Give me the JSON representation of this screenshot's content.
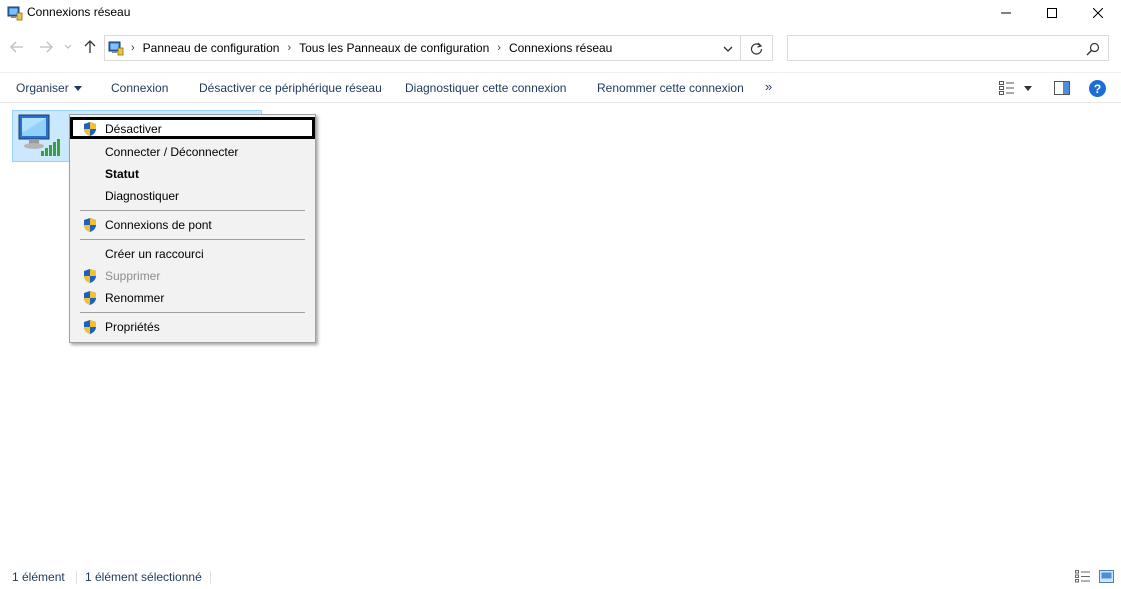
{
  "window": {
    "title": "Connexions réseau",
    "controls": [
      "minimize",
      "maximize",
      "close"
    ]
  },
  "address_bar": {
    "breadcrumbs": [
      {
        "label": "Panneau de configuration"
      },
      {
        "label": "Tous les Panneaux de configuration"
      },
      {
        "label": "Connexions réseau"
      }
    ],
    "search_value": ""
  },
  "command_bar": {
    "organiser": "Organiser",
    "connexion": "Connexion",
    "desactiver": "Désactiver ce périphérique réseau",
    "diagnostiquer": "Diagnostiquer cette connexion",
    "renommer": "Renommer cette connexion",
    "more": "»",
    "help": "?"
  },
  "context_menu": {
    "items": [
      {
        "label": "Désactiver",
        "shield": true,
        "bold": false,
        "disabled": false,
        "focused": true
      },
      {
        "label": "Connecter / Déconnecter",
        "shield": false,
        "bold": false,
        "disabled": false,
        "focused": false
      },
      {
        "label": "Statut",
        "shield": false,
        "bold": true,
        "disabled": false,
        "focused": false
      },
      {
        "label": "Diagnostiquer",
        "shield": false,
        "bold": false,
        "disabled": false,
        "focused": false
      },
      {
        "label": "Connexions de pont",
        "shield": true,
        "bold": false,
        "disabled": false,
        "focused": false
      },
      {
        "label": "Créer un raccourci",
        "shield": false,
        "bold": false,
        "disabled": false,
        "focused": false
      },
      {
        "label": "Supprimer",
        "shield": true,
        "bold": false,
        "disabled": true,
        "focused": false
      },
      {
        "label": "Renommer",
        "shield": true,
        "bold": false,
        "disabled": false,
        "focused": false
      },
      {
        "label": "Propriétés",
        "shield": true,
        "bold": false,
        "disabled": false,
        "focused": false
      }
    ]
  },
  "status_bar": {
    "count": "1 élément",
    "selected": "1 élément sélectionné"
  },
  "colors": {
    "accent_text": "#1e395b",
    "selection_bg": "#cce8ff",
    "selection_border": "#99d1ff",
    "menu_bg": "#f2f2f2",
    "help_blue": "#1b6ed4"
  }
}
